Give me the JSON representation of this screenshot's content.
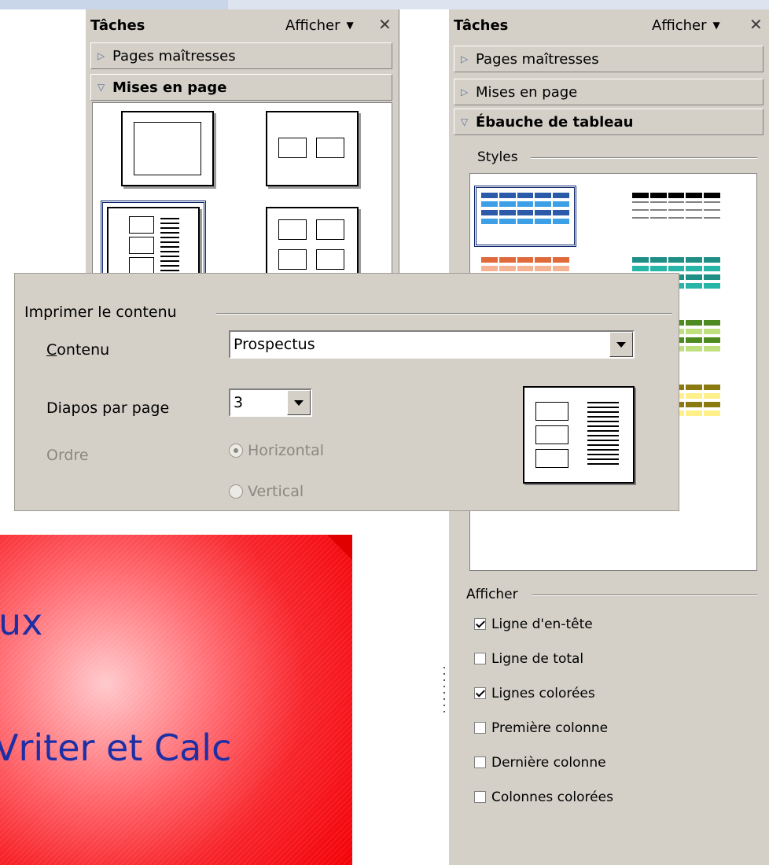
{
  "left_panel": {
    "title": "Tâches",
    "view_label": "Afficher",
    "sections": {
      "master_pages": "Pages maîtresses",
      "layouts": "Mises en page"
    }
  },
  "right_panel": {
    "title": "Tâches",
    "view_label": "Afficher",
    "sections": {
      "master_pages": "Pages maîtresses",
      "layouts": "Mises en page",
      "table_design": "Ébauche de tableau"
    },
    "styles_label": "Styles",
    "show_label": "Afficher",
    "options": [
      {
        "label": "Ligne d'en-tête",
        "checked": true
      },
      {
        "label": "Ligne de total",
        "checked": false
      },
      {
        "label": "Lignes colorées",
        "checked": true
      },
      {
        "label": "Première colonne",
        "checked": false
      },
      {
        "label": "Dernière colonne",
        "checked": false
      },
      {
        "label": "Colonnes colorées",
        "checked": false
      }
    ],
    "table_styles": [
      {
        "name": "blue",
        "head": "#2b5aa8",
        "body": "#3da0e6"
      },
      {
        "name": "black",
        "head": "#000000",
        "body": "#808080"
      },
      {
        "name": "orange",
        "head": "#e06a3c",
        "body": "#f4b493"
      },
      {
        "name": "teal",
        "head": "#1f8f86",
        "body": "#27b5a8"
      },
      {
        "name": "violet",
        "head": "#6464c8",
        "body": "#a7a7e8"
      },
      {
        "name": "green",
        "head": "#4e8a20",
        "body": "#c0e080"
      },
      {
        "name": "lilac",
        "head": "#6464c8",
        "body": "#a7a7e8"
      },
      {
        "name": "yellow",
        "head": "#8a7a10",
        "body": "#fff08a"
      }
    ]
  },
  "dialog": {
    "legend": "Imprimer le contenu",
    "content_label": "Contenu",
    "content_value": "Prospectus",
    "slides_label": "Diapos par page",
    "slides_value": "3",
    "order_label": "Ordre",
    "order_horizontal": "Horizontal",
    "order_vertical": "Vertical"
  },
  "slide": {
    "line1": "ux",
    "line2": "Vriter et Calc"
  }
}
